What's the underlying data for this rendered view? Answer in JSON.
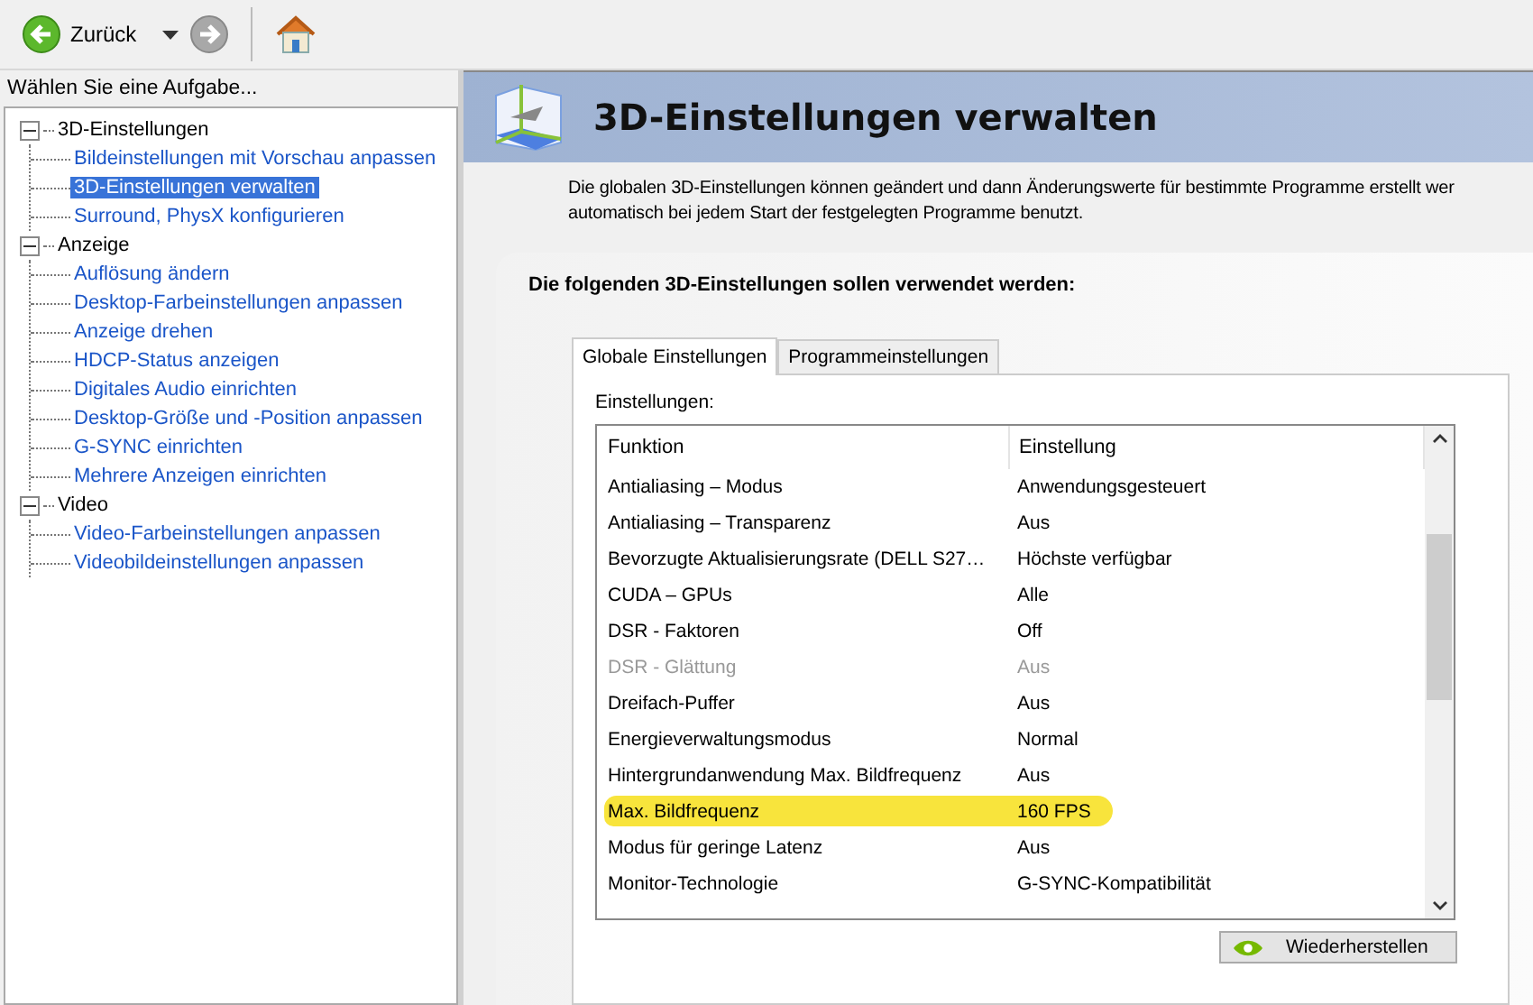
{
  "toolbar": {
    "back_label": "Zurück"
  },
  "sidebar": {
    "title": "Wählen Sie eine Aufgabe...",
    "tree": [
      {
        "label": "3D-Einstellungen",
        "expanded": true,
        "children": [
          {
            "label": "Bildeinstellungen mit Vorschau anpassen",
            "selected": false
          },
          {
            "label": "3D-Einstellungen verwalten",
            "selected": true
          },
          {
            "label": "Surround, PhysX konfigurieren",
            "selected": false
          }
        ]
      },
      {
        "label": "Anzeige",
        "expanded": true,
        "children": [
          {
            "label": "Auflösung ändern",
            "selected": false
          },
          {
            "label": "Desktop-Farbeinstellungen anpassen",
            "selected": false
          },
          {
            "label": "Anzeige drehen",
            "selected": false
          },
          {
            "label": "HDCP-Status anzeigen",
            "selected": false
          },
          {
            "label": "Digitales Audio einrichten",
            "selected": false
          },
          {
            "label": "Desktop-Größe und -Position anpassen",
            "selected": false
          },
          {
            "label": "G-SYNC einrichten",
            "selected": false
          },
          {
            "label": "Mehrere Anzeigen einrichten",
            "selected": false
          }
        ]
      },
      {
        "label": "Video",
        "expanded": true,
        "children": [
          {
            "label": "Video-Farbeinstellungen anpassen",
            "selected": false
          },
          {
            "label": "Videobildeinstellungen anpassen",
            "selected": false
          }
        ]
      }
    ]
  },
  "page": {
    "title": "3D-Einstellungen verwalten",
    "description": [
      "Die globalen 3D-Einstellungen können geändert und dann Änderungswerte für bestimmte Programme erstellt wer",
      "automatisch bei jedem Start der festgelegten Programme benutzt."
    ],
    "section_title": "Die folgenden 3D-Einstellungen sollen verwendet werden:"
  },
  "tabs": [
    {
      "label": "Globale Einstellungen",
      "selected": true
    },
    {
      "label": "Programmeinstellungen",
      "selected": false
    }
  ],
  "settings": {
    "label": "Einstellungen:",
    "columns": [
      "Funktion",
      "Einstellung"
    ],
    "rows": [
      {
        "function": "Antialiasing – Modus",
        "value": "Anwendungsgesteuert",
        "disabled": false,
        "highlighted": false
      },
      {
        "function": "Antialiasing – Transparenz",
        "value": "Aus",
        "disabled": false,
        "highlighted": false
      },
      {
        "function": "Bevorzugte Aktualisierungsrate (DELL S27…",
        "value": "Höchste verfügbar",
        "disabled": false,
        "highlighted": false
      },
      {
        "function": "CUDA – GPUs",
        "value": "Alle",
        "disabled": false,
        "highlighted": false
      },
      {
        "function": "DSR - Faktoren",
        "value": "Off",
        "disabled": false,
        "highlighted": false
      },
      {
        "function": "DSR - Glättung",
        "value": "Aus",
        "disabled": true,
        "highlighted": false
      },
      {
        "function": "Dreifach-Puffer",
        "value": "Aus",
        "disabled": false,
        "highlighted": false
      },
      {
        "function": "Energieverwaltungsmodus",
        "value": "Normal",
        "disabled": false,
        "highlighted": false
      },
      {
        "function": "Hintergrundanwendung Max. Bildfrequenz",
        "value": "Aus",
        "disabled": false,
        "highlighted": false
      },
      {
        "function": "Max. Bildfrequenz",
        "value": "160 FPS",
        "disabled": false,
        "highlighted": true
      },
      {
        "function": "Modus für geringe Latenz",
        "value": "Aus",
        "disabled": false,
        "highlighted": false
      },
      {
        "function": "Monitor-Technologie",
        "value": "G-SYNC-Kompatibilität",
        "disabled": false,
        "highlighted": false
      }
    ]
  },
  "restore_button": "Wiederherstellen"
}
